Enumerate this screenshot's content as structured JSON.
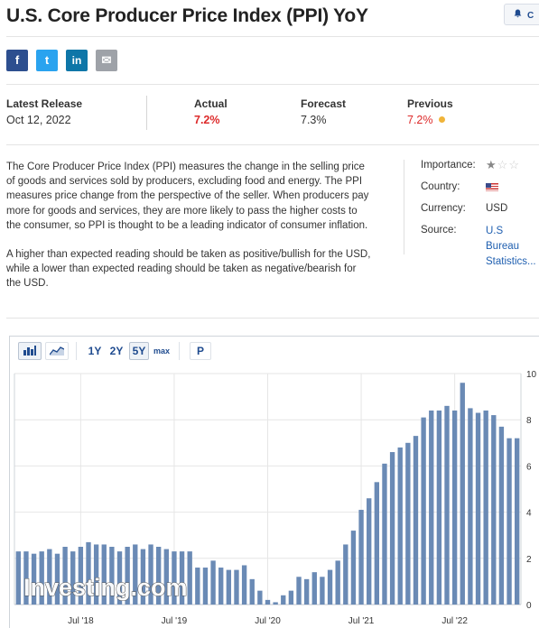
{
  "header": {
    "title": "U.S. Core Producer Price Index (PPI) YoY",
    "alert_label": "C"
  },
  "share": {
    "facebook": "f",
    "twitter": "t",
    "linkedin": "in",
    "email": "✉"
  },
  "release": {
    "latest_label": "Latest Release",
    "latest_value": "Oct 12, 2022",
    "actual_label": "Actual",
    "actual_value": "7.2%",
    "forecast_label": "Forecast",
    "forecast_value": "7.3%",
    "previous_label": "Previous",
    "previous_value": "7.2%"
  },
  "description": {
    "p1": "The Core Producer Price Index (PPI) measures the change in the selling price of goods and services sold by producers, excluding food and energy. The PPI measures price change from the perspective of the seller. When producers pay more for goods and services, they are more likely to pass the higher costs to the consumer, so PPI is thought to be a leading indicator of consumer inflation.",
    "p2": "A higher than expected reading should be taken as positive/bullish for the USD, while a lower than expected reading should be taken as negative/bearish for the USD."
  },
  "details": {
    "importance_label": "Importance:",
    "importance_stars": 1,
    "country_label": "Country:",
    "currency_label": "Currency:",
    "currency_value": "USD",
    "source_label": "Source:",
    "source_line1": "U.S Bureau",
    "source_line2": "Statistics..."
  },
  "toolbar": {
    "bar_chart_icon": "bar-chart-icon",
    "area_chart_icon": "area-chart-icon",
    "range_1y": "1Y",
    "range_2y": "2Y",
    "range_5y": "5Y",
    "range_max": "max",
    "p_button": "P",
    "selected_range": "5Y"
  },
  "colors": {
    "bar": "#6a8ab5",
    "actual": "#dd2a2a",
    "previous_dot": "#f0b43a",
    "link": "#1f5fb0"
  },
  "chart_data": {
    "type": "bar",
    "watermark": "Investing.com",
    "ylim": [
      0,
      10
    ],
    "y_ticks": [
      0,
      2,
      4,
      6,
      8,
      10
    ],
    "x_tick_labels": [
      "Jul '18",
      "Jul '19",
      "Jul '20",
      "Jul '21",
      "Jul '22"
    ],
    "x_tick_indices": [
      8,
      20,
      32,
      44,
      56
    ],
    "grid": true,
    "values": [
      2.3,
      2.3,
      2.2,
      2.3,
      2.4,
      2.2,
      2.5,
      2.3,
      2.5,
      2.7,
      2.6,
      2.6,
      2.5,
      2.3,
      2.5,
      2.6,
      2.4,
      2.6,
      2.5,
      2.4,
      2.3,
      2.3,
      2.3,
      1.6,
      1.6,
      1.9,
      1.6,
      1.5,
      1.5,
      1.7,
      1.1,
      0.6,
      0.2,
      0.1,
      0.4,
      0.6,
      1.2,
      1.1,
      1.4,
      1.2,
      1.5,
      1.9,
      2.6,
      3.2,
      4.1,
      4.6,
      5.3,
      6.1,
      6.6,
      6.8,
      7.0,
      7.3,
      8.1,
      8.4,
      8.4,
      8.6,
      8.4,
      9.6,
      8.5,
      8.3,
      8.4,
      8.2,
      7.7,
      7.2,
      7.2
    ]
  }
}
